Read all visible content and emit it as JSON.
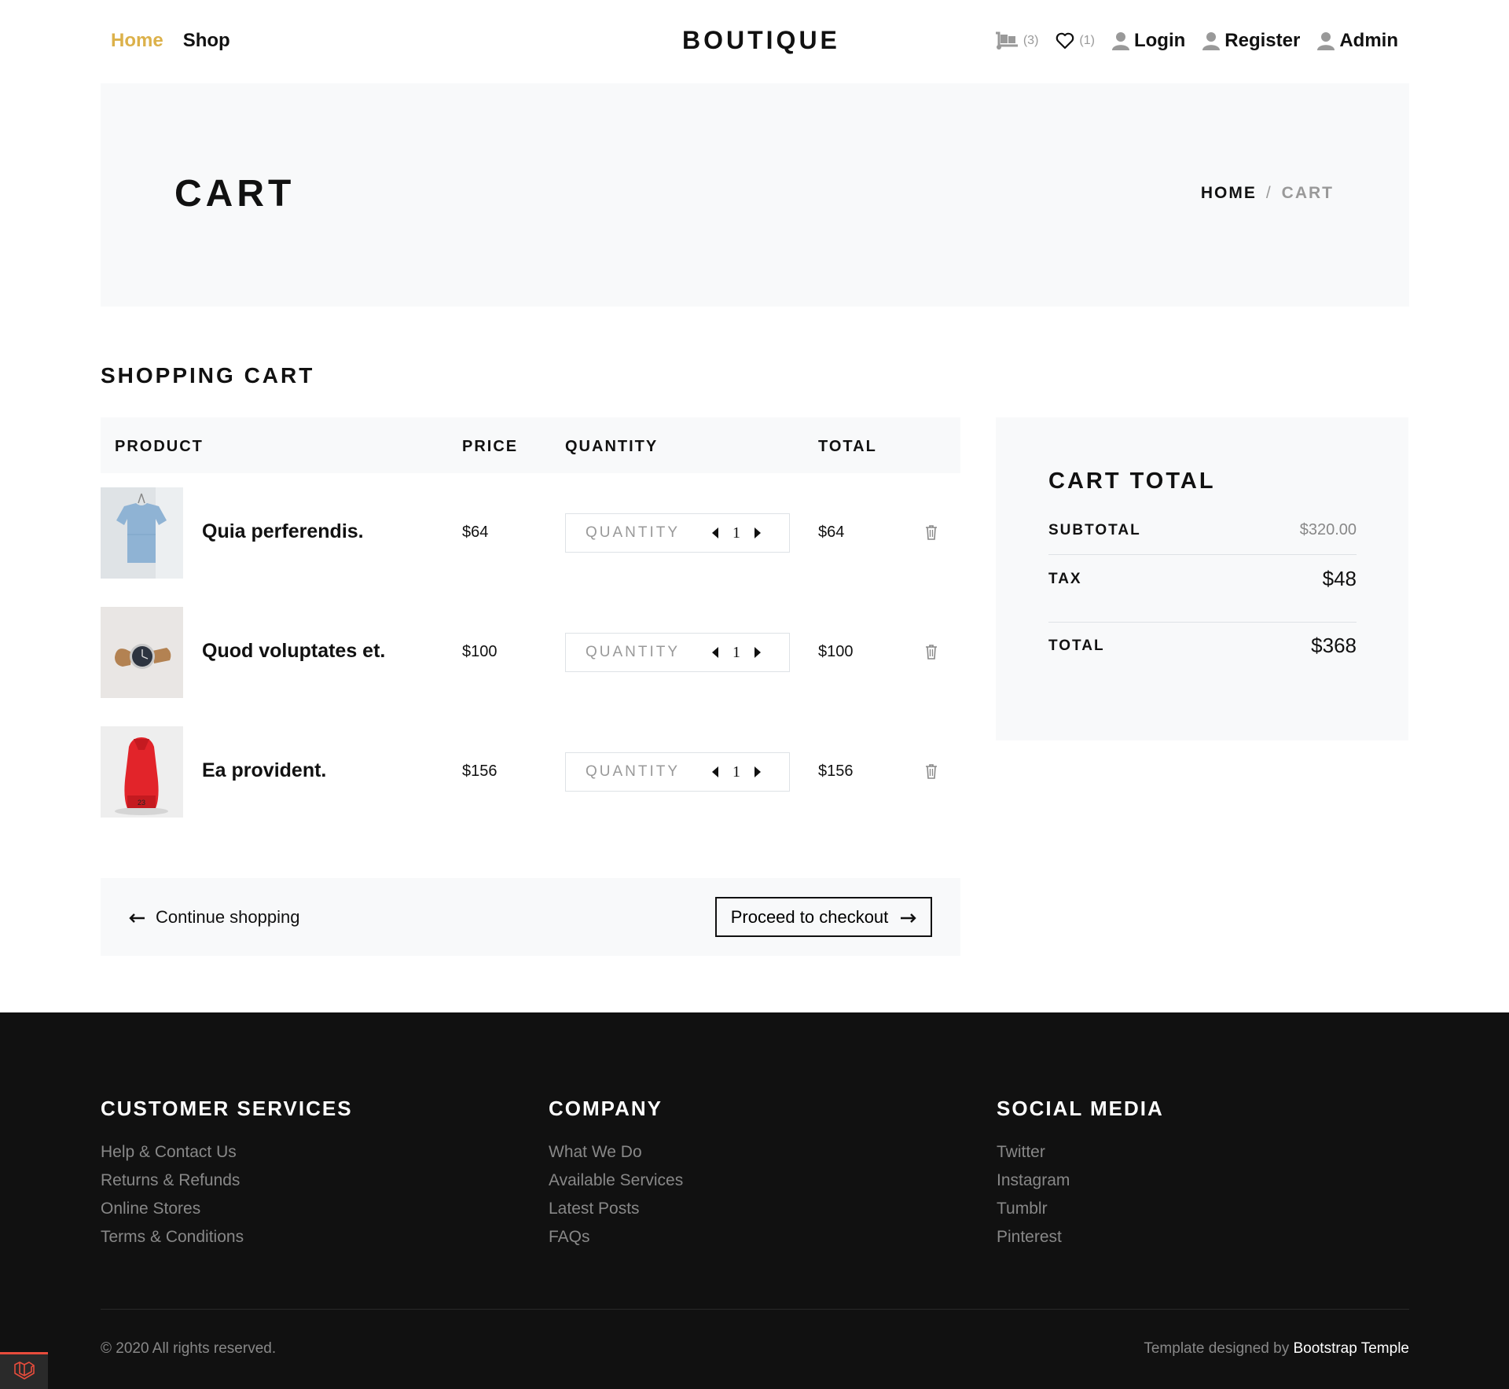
{
  "nav": {
    "links": [
      {
        "label": "Home",
        "active": true
      },
      {
        "label": "Shop",
        "active": false
      }
    ],
    "brand": "BOUTIQUE",
    "cart_count": "(3)",
    "wishlist_count": "(1)",
    "login": "Login",
    "register": "Register",
    "admin": "Admin"
  },
  "hero": {
    "title": "CART",
    "breadcrumb_home": "HOME",
    "breadcrumb_sep": "/",
    "breadcrumb_current": "CART"
  },
  "section_title": "SHOPPING CART",
  "table": {
    "headers": {
      "product": "PRODUCT",
      "price": "PRICE",
      "quantity": "QUANTITY",
      "total": "TOTAL"
    },
    "rows": [
      {
        "name": "Quia perferendis.",
        "price": "$64",
        "qty_label": "QUANTITY",
        "qty": "1",
        "total": "$64",
        "image": "tshirt"
      },
      {
        "name": "Quod voluptates et.",
        "price": "$100",
        "qty_label": "QUANTITY",
        "qty": "1",
        "total": "$100",
        "image": "watch"
      },
      {
        "name": "Ea provident.",
        "price": "$156",
        "qty_label": "QUANTITY",
        "qty": "1",
        "total": "$156",
        "image": "sneaker"
      }
    ]
  },
  "actions": {
    "continue": "Continue shopping",
    "checkout": "Proceed to checkout"
  },
  "cart_total": {
    "title": "CART TOTAL",
    "subtotal_label": "SUBTOTAL",
    "subtotal_value": "$320.00",
    "tax_label": "TAX",
    "tax_value": "$48",
    "total_label": "TOTAL",
    "total_value": "$368"
  },
  "footer": {
    "customer_services": {
      "title": "CUSTOMER SERVICES",
      "links": [
        "Help & Contact Us",
        "Returns & Refunds",
        "Online Stores",
        "Terms & Conditions"
      ]
    },
    "company": {
      "title": "COMPANY",
      "links": [
        "What We Do",
        "Available Services",
        "Latest Posts",
        "FAQs"
      ]
    },
    "social": {
      "title": "SOCIAL MEDIA",
      "links": [
        "Twitter",
        "Instagram",
        "Tumblr",
        "Pinterest"
      ]
    },
    "copyright": "© 2020 All rights reserved.",
    "credit_prefix": "Template designed by",
    "credit_link": "Bootstrap Temple"
  },
  "colors": {
    "accent": "#dcb14a",
    "light_bg": "#f8f9fa",
    "footer_bg": "#111111",
    "laravel_red": "#e74c3c"
  },
  "icons": {
    "cart": "dolly-icon",
    "wishlist": "heart-icon",
    "user": "user-icon",
    "remove": "trash-icon",
    "arrow_left": "arrow-left-icon",
    "arrow_right": "arrow-right-icon",
    "badge": "laravel-icon"
  }
}
